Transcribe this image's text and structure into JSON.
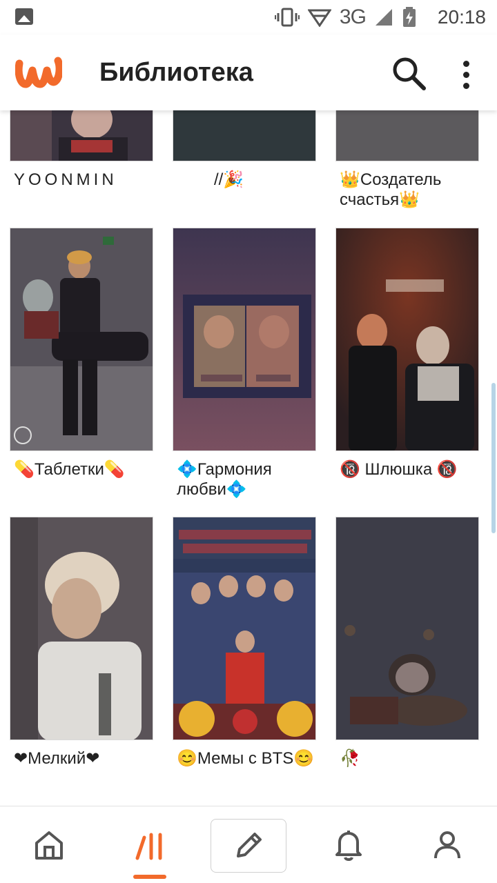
{
  "status_bar": {
    "network": "3G",
    "time": "20:18"
  },
  "app_bar": {
    "title": "Библиотека",
    "logo_icon": "wattpad-logo",
    "brand_color": "#f26a2b"
  },
  "library": {
    "items": [
      {
        "title": "YOONMIN",
        "cover_colors": [
          "#3b3440",
          "#6a4b55"
        ]
      },
      {
        "title": "//🎉",
        "cover_colors": [
          "#2f383c",
          "#2f383c"
        ]
      },
      {
        "title": "👑Создатель счастья👑",
        "cover_colors": [
          "#5c5a5d",
          "#5c5a5d"
        ]
      },
      {
        "title": "💊Таблетки💊",
        "cover_colors": [
          "#4a4550",
          "#2c2830"
        ]
      },
      {
        "title": "💠Гармония любви💠",
        "cover_colors": [
          "#4b3a50",
          "#6d4a5c"
        ]
      },
      {
        "title": "🔞 Шлюшка 🔞",
        "cover_colors": [
          "#3a2828",
          "#5a2c22"
        ]
      },
      {
        "title": "❤Мелкий❤",
        "cover_colors": [
          "#5a5358",
          "#4a4448"
        ]
      },
      {
        "title": "😊Мемы с BTS😊",
        "cover_colors": [
          "#2e3a5a",
          "#6a2a2a"
        ]
      },
      {
        "title": "🥀",
        "cover_colors": [
          "#3d3d48",
          "#3a3840"
        ]
      }
    ]
  },
  "bottom_nav": {
    "items": [
      {
        "name": "home",
        "icon": "home-icon"
      },
      {
        "name": "library",
        "icon": "library-icon",
        "active": true
      },
      {
        "name": "write",
        "icon": "pencil-icon"
      },
      {
        "name": "notifications",
        "icon": "bell-icon"
      },
      {
        "name": "profile",
        "icon": "profile-icon"
      }
    ],
    "active_color": "#f26a2b",
    "inactive_color": "#555555"
  }
}
